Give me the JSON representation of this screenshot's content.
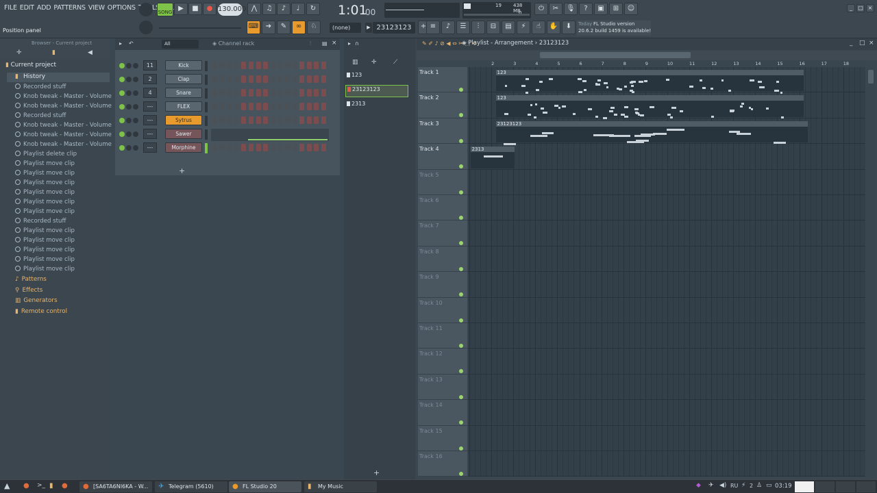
{
  "menu": [
    "FILE",
    "EDIT",
    "ADD",
    "PATTERNS",
    "VIEW",
    "OPTIONS",
    "TOOLS",
    "HELP"
  ],
  "transport": {
    "mode": "SONG",
    "tempo": "130.000",
    "time": "1:01",
    "time_sub": "00",
    "cpu": "19",
    "ram": "438 MB",
    "voices": "0"
  },
  "hint": {
    "left": "Position panel",
    "news_title": "Today",
    "news_app": "FL Studio version",
    "news_body": "20.6.2 build 1459 is available!"
  },
  "pattern_selector": {
    "none_label": "(none)",
    "current": "23123123"
  },
  "browser": {
    "title": "Browser - Current project",
    "root": "Current project",
    "history_label": "History",
    "history": [
      "Recorded stuff",
      "Knob tweak - Master - Volume",
      "Knob tweak - Master - Volume",
      "Recorded stuff",
      "Knob tweak - Master - Volume",
      "Knob tweak - Master - Volume",
      "Knob tweak - Master - Volume",
      "Playlist delete clip",
      "Playlist move clip",
      "Playlist move clip",
      "Playlist move clip",
      "Playlist move clip",
      "Playlist move clip",
      "Playlist move clip",
      "Recorded stuff",
      "Playlist move clip",
      "Playlist move clip",
      "Playlist move clip",
      "Playlist move clip",
      "Playlist move clip"
    ],
    "folders": [
      "Patterns",
      "Effects",
      "Generators",
      "Remote control"
    ]
  },
  "channel_rack": {
    "filter": "All",
    "title": "Channel rack",
    "channels": [
      {
        "num": "11",
        "name": "Kick"
      },
      {
        "num": "2",
        "name": "Clap"
      },
      {
        "num": "4",
        "name": "Snare"
      },
      {
        "num": "---",
        "name": "FLEX"
      },
      {
        "num": "---",
        "name": "Sytrus"
      },
      {
        "num": "---",
        "name": "Sawer"
      },
      {
        "num": "---",
        "name": "Morphine"
      }
    ],
    "add_label": "+"
  },
  "patterns": [
    {
      "name": "123"
    },
    {
      "name": "23123123"
    },
    {
      "name": "2313"
    }
  ],
  "pattern_add_label": "+",
  "playlist": {
    "title": "Playlist - Arrangement",
    "crumb": "23123123",
    "bars": [
      "2",
      "3",
      "4",
      "5",
      "6",
      "7",
      "8",
      "9",
      "10",
      "11",
      "12",
      "13",
      "14",
      "15",
      "16",
      "17",
      "18"
    ],
    "tracks": [
      "Track 1",
      "Track 2",
      "Track 3",
      "Track 4",
      "Track 5",
      "Track 6",
      "Track 7",
      "Track 8",
      "Track 9",
      "Track 10",
      "Track 11",
      "Track 12",
      "Track 13",
      "Track 14",
      "Track 15",
      "Track 16"
    ],
    "clips": [
      {
        "track": 0,
        "label": "123",
        "start": 1.2,
        "len": 14.0
      },
      {
        "track": 1,
        "label": "123",
        "start": 1.2,
        "len": 14.0
      },
      {
        "track": 2,
        "label": "23123123",
        "start": 1.2,
        "len": 14.2
      },
      {
        "track": 3,
        "label": "2313",
        "start": 0.05,
        "len": 2.0
      }
    ]
  },
  "taskbar": {
    "tasks": [
      "[SA6TA6NI6KA - W...",
      "Telegram (5610)",
      "FL Studio 20",
      "My Music"
    ],
    "lang": "RU",
    "count": "2",
    "clock": "03:19"
  }
}
